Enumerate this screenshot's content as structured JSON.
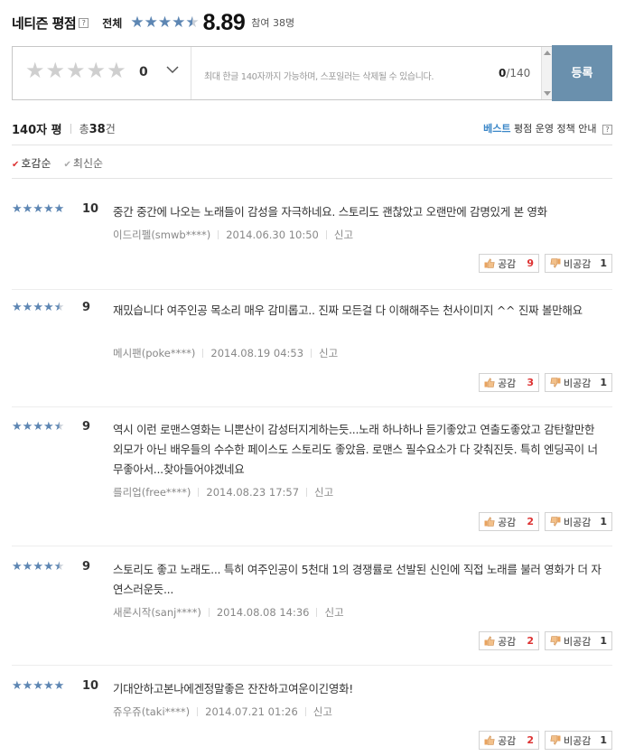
{
  "header": {
    "title": "네티즌 평점",
    "help": "?",
    "overall_label": "전체",
    "overall_score": "8.89",
    "overall_stars": 4.5,
    "participants": "참여 38명"
  },
  "input": {
    "rating_value": "0",
    "placeholder": "최대 한글 140자까지 가능하며, 스포일러는 삭제될 수 있습니다.",
    "char_count": "0",
    "char_max": "/140",
    "submit_label": "등록"
  },
  "meta": {
    "label": "140자 평",
    "total_prefix": "총",
    "total_count": "38",
    "total_suffix": "건",
    "policy_best": "베스트",
    "policy_rest": " 평점 운영 정책 안내",
    "policy_help": "?"
  },
  "sort": {
    "options": [
      "호감순",
      "최신순"
    ],
    "active": 0
  },
  "actions": {
    "like_label": "공감",
    "dislike_label": "비공감",
    "report_label": "신고"
  },
  "reviews": [
    {
      "stars": 5,
      "score": "10",
      "text": "중간 중간에 나오는 노래들이 감성을 자극하네요. 스토리도 괜찮았고 오랜만에 감명있게 본 영화",
      "user": "이드리펠(smwb****)",
      "date": "2014.06.30 10:50",
      "likes": "9",
      "dislikes": "1"
    },
    {
      "stars": 4.5,
      "score": "9",
      "text": "재밌습니다 여주인공 목소리 매우 감미롭고.. 진짜 모든걸 다 이해해주는 천사이미지 ^^ 진짜 볼만해요",
      "user": "메시팬(poke****)",
      "date": "2014.08.19 04:53",
      "likes": "3",
      "dislikes": "1"
    },
    {
      "stars": 4.5,
      "score": "9",
      "text": "역시 이런 로맨스영화는 니뽄산이 감성터지게하는듯...노래 하나하나 듣기좋았고 연출도좋았고 감탄할만한 외모가 아닌 배우들의 수수한 페이스도 스토리도 좋았음. 로맨스 필수요소가 다 갖춰진듯. 특히 엔딩곡이 너무좋아서...찾아들어야겠네요",
      "user": "를리업(free****)",
      "date": "2014.08.23 17:57",
      "likes": "2",
      "dislikes": "1"
    },
    {
      "stars": 4.5,
      "score": "9",
      "text": "스토리도 좋고 노래도... 특히 여주인공이 5천대 1의 경쟁률로 선발된 신인에 직접 노래를 불러 영화가 더 자연스러운듯...",
      "user": "새론시작(sanj****)",
      "date": "2014.08.08 14:36",
      "likes": "2",
      "dislikes": "1"
    },
    {
      "stars": 5,
      "score": "10",
      "text": "기대안하고본나에겐정말좋은 잔잔하고여운이긴영화!",
      "user": "쥬우쥬(taki****)",
      "date": "2014.07.21 01:26",
      "likes": "2",
      "dislikes": "1"
    }
  ],
  "colors": {
    "star": "#5d86b3",
    "submit": "#6a90ad",
    "accent_blue": "#3b87c8",
    "like_red": "#dd3333"
  }
}
